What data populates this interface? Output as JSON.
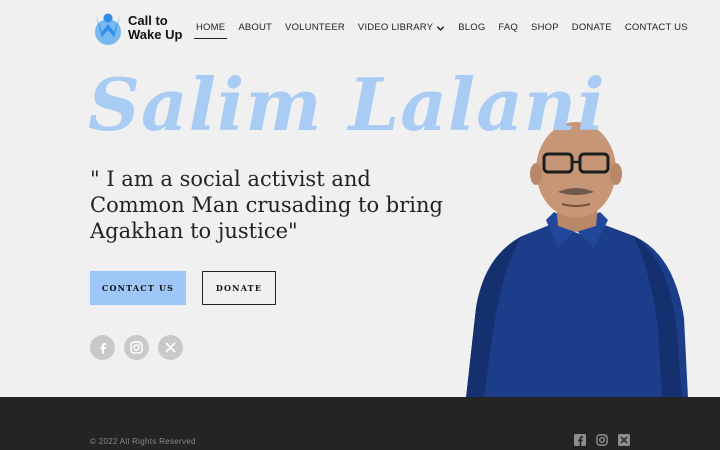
{
  "brand": {
    "line1": "Call to",
    "line2": "Wake Up",
    "accent": "#2f8fe8",
    "accent_light": "#7ab8f2"
  },
  "nav": {
    "items": [
      {
        "label": "HOME",
        "active": true
      },
      {
        "label": "ABOUT"
      },
      {
        "label": "VOLUNTEER"
      },
      {
        "label": "VIDEO LIBRARY",
        "dropdown": true
      },
      {
        "label": "BLOG"
      },
      {
        "label": "FAQ"
      },
      {
        "label": "SHOP"
      },
      {
        "label": "DONATE"
      },
      {
        "label": "CONTACT US"
      }
    ]
  },
  "hero": {
    "name": "Salim Lalani",
    "quote": "\" I am a social activist and Common Man crusading to bring Agakhan to justice\"",
    "name_color": "#a9ccf5",
    "buttons": {
      "contact": "CONTACT US",
      "donate": "DONATE"
    },
    "contact_button_color": "#9ec6f6"
  },
  "social": {
    "icons": [
      "facebook-icon",
      "instagram-icon",
      "x-icon"
    ]
  },
  "footer": {
    "copyright": "© 2022 All Rights Reserved",
    "background": "#242424"
  }
}
